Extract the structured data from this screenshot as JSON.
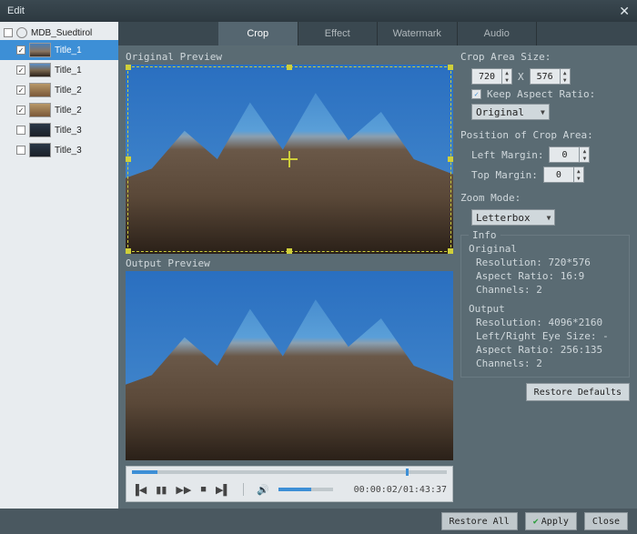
{
  "window": {
    "title": "Edit"
  },
  "sidebar": {
    "root": "MDB_Suedtirol",
    "items": [
      {
        "label": "Title_1",
        "checked": true,
        "selected": true,
        "thumb": "d0"
      },
      {
        "label": "Title_1",
        "checked": true,
        "selected": false,
        "thumb": "d1"
      },
      {
        "label": "Title_2",
        "checked": true,
        "selected": false,
        "thumb": "d2"
      },
      {
        "label": "Title_2",
        "checked": true,
        "selected": false,
        "thumb": "d2"
      },
      {
        "label": "Title_3",
        "checked": false,
        "selected": false,
        "thumb": "d3"
      },
      {
        "label": "Title_3",
        "checked": false,
        "selected": false,
        "thumb": "d3"
      }
    ]
  },
  "tabs": {
    "items": [
      "Crop",
      "Effect",
      "Watermark",
      "Audio"
    ],
    "active": 0
  },
  "preview": {
    "original_label": "Original Preview",
    "output_label": "Output Preview"
  },
  "crop": {
    "size_label": "Crop Area Size:",
    "width": "720",
    "sep": "X",
    "height": "576",
    "keep_ar_label": "Keep Aspect Ratio:",
    "keep_ar_checked": true,
    "ar_select": "Original",
    "pos_label": "Position of Crop Area:",
    "left_label": "Left Margin:",
    "left_val": "0",
    "top_label": "Top Margin:",
    "top_val": "0",
    "zoom_label": "Zoom Mode:",
    "zoom_select": "Letterbox"
  },
  "info": {
    "legend": "Info",
    "orig_hdr": "Original",
    "orig_res": "Resolution: 720*576",
    "orig_ar": "Aspect Ratio: 16:9",
    "orig_ch": "Channels: 2",
    "out_hdr": "Output",
    "out_res": "Resolution: 4096*2160",
    "out_eye": "Left/Right Eye Size: -",
    "out_ar": "Aspect Ratio: 256:135",
    "out_ch": "Channels: 2",
    "restore_defaults": "Restore Defaults"
  },
  "player": {
    "time": "00:00:02/01:43:37"
  },
  "footer": {
    "restore_all": "Restore All",
    "apply": "Apply",
    "close": "Close"
  }
}
